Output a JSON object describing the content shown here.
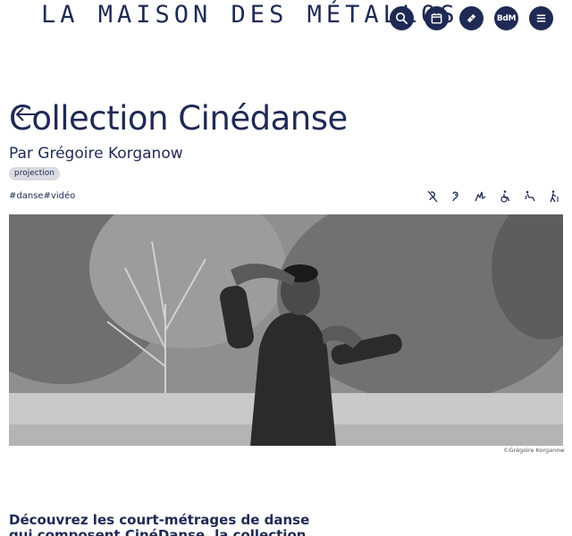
{
  "site": {
    "logo": "LA MAISON DES MÉTALLOS"
  },
  "header": {
    "icons": [
      {
        "name": "search-icon"
      },
      {
        "name": "calendar-icon"
      },
      {
        "name": "ticket-icon"
      },
      {
        "name": "bdm-icon",
        "label": "BdM"
      },
      {
        "name": "menu-icon"
      }
    ]
  },
  "page": {
    "title": "Collection Cinédanse",
    "subtitle": "Par Grégoire Korganow",
    "badge": "projection",
    "tags": "#danse#vidéo"
  },
  "accessibility_icons": [
    "hearing-impaired-icon",
    "hearing-aid-icon",
    "sign-language-icon",
    "wheelchair-icon",
    "reduced-mobility-icon",
    "walking-cane-icon"
  ],
  "hero": {
    "credit": "©Grégoire Korganow"
  },
  "intro": {
    "text": "Découvrez les court-métrages de danse qui composent CinéDanse, la collection produite par",
    "side_fragment": "",
    "side_label": ""
  },
  "colors": {
    "accent": "#1f2a54",
    "badge_bg": "#dadbe0"
  }
}
